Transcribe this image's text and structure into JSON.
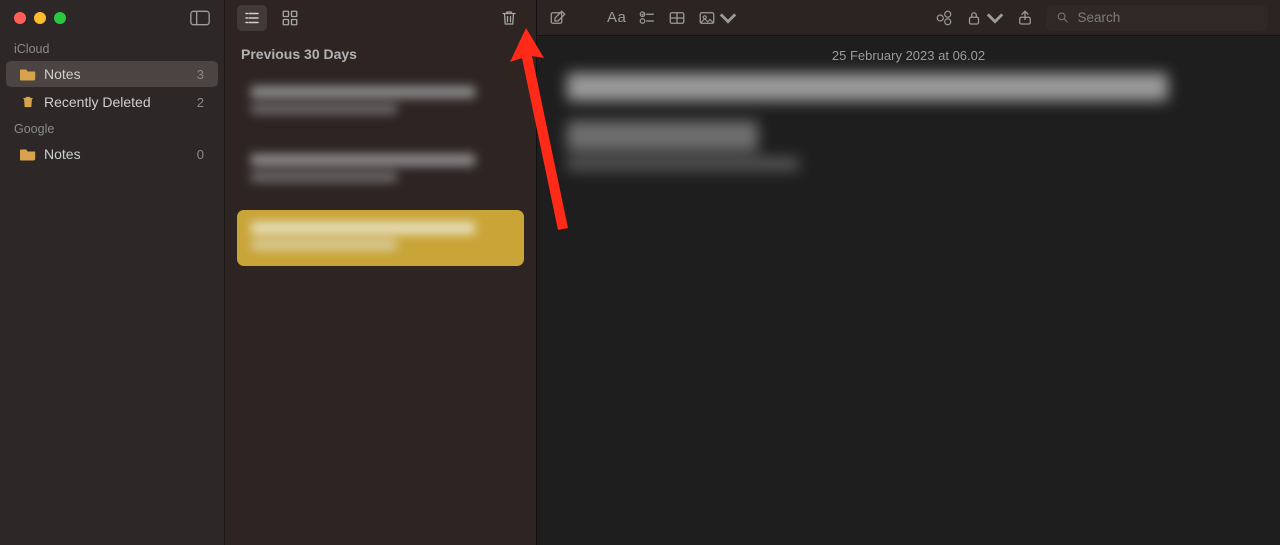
{
  "sidebar": {
    "sections": [
      {
        "title": "iCloud",
        "items": [
          {
            "icon": "folder",
            "label": "Notes",
            "count": "3",
            "selected": true,
            "name": "sidebar-icloud-notes"
          },
          {
            "icon": "trash",
            "label": "Recently Deleted",
            "count": "2",
            "selected": false,
            "name": "sidebar-recently-deleted"
          }
        ]
      },
      {
        "title": "Google",
        "items": [
          {
            "icon": "folder",
            "label": "Notes",
            "count": "0",
            "selected": false,
            "name": "sidebar-google-notes"
          }
        ]
      }
    ]
  },
  "note_list": {
    "group_header": "Previous 30 Days"
  },
  "editor": {
    "timestamp": "25 February 2023 at 06.02",
    "aa_label": "Aa",
    "search_placeholder": "Search"
  }
}
